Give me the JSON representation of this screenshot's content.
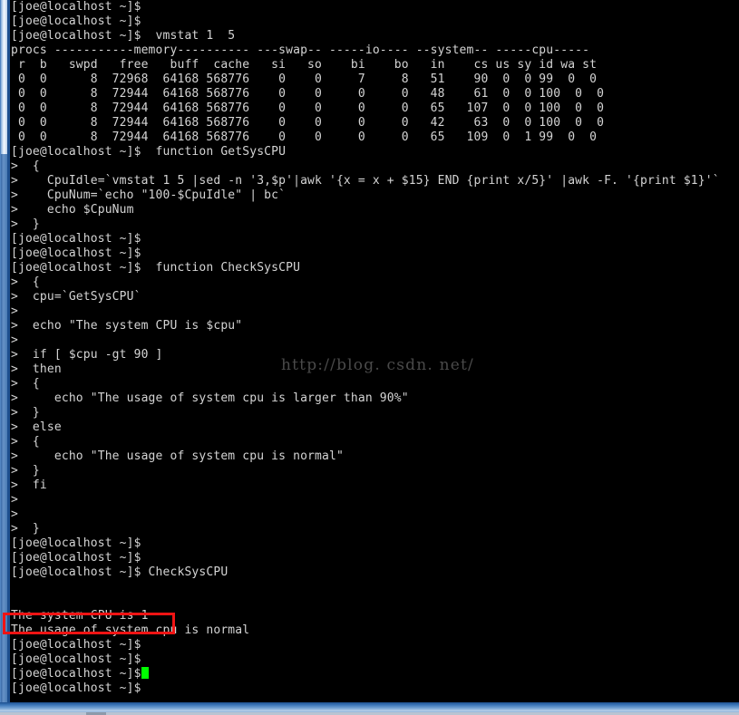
{
  "window": {
    "type": "terminal-emulator",
    "background_color": "#000000",
    "text_color": "#d4d4d4",
    "frame_color": "#3f79ba",
    "cursor_color": "#00ff00"
  },
  "watermark": {
    "text": "http://blog. csdn. net/"
  },
  "annotation": {
    "type": "red-rectangle-highlight",
    "color": "#f01414",
    "targets_line": "The system CPU is 1"
  },
  "terminal": {
    "prompt": "[joe@localhost ~]$",
    "continuation_prompt": ">",
    "lines": [
      "[joe@localhost ~]$",
      "[joe@localhost ~]$",
      "[joe@localhost ~]$  vmstat 1  5",
      "procs -----------memory---------- ---swap-- -----io---- --system-- -----cpu-----",
      " r  b   swpd   free   buff  cache   si   so    bi    bo   in    cs us sy id wa st",
      " 0  0      8  72968  64168 568776    0    0     7     8   51    90  0  0 99  0  0",
      " 0  0      8  72944  64168 568776    0    0     0     0   48    61  0  0 100  0  0",
      " 0  0      8  72944  64168 568776    0    0     0     0   65   107  0  0 100  0  0",
      " 0  0      8  72944  64168 568776    0    0     0     0   42    63  0  0 100  0  0",
      " 0  0      8  72944  64168 568776    0    0     0     0   65   109  0  1 99  0  0",
      "[joe@localhost ~]$  function GetSysCPU",
      ">  {",
      ">    CpuIdle=`vmstat 1 5 |sed -n '3,$p'|awk '{x = x + $15} END {print x/5}' |awk -F. '{print $1}'`",
      ">    CpuNum=`echo \"100-$CpuIdle\" | bc`",
      ">    echo $CpuNum",
      ">  }",
      "[joe@localhost ~]$",
      "[joe@localhost ~]$",
      "[joe@localhost ~]$  function CheckSysCPU",
      ">  {",
      ">  cpu=`GetSysCPU`",
      ">",
      ">  echo \"The system CPU is $cpu\"",
      ">",
      ">  if [ $cpu -gt 90 ]",
      ">  then",
      ">  {",
      ">     echo \"The usage of system cpu is larger than 90%\"",
      ">  }",
      ">  else",
      ">  {",
      ">     echo \"The usage of system cpu is normal\"",
      ">  }",
      ">  fi",
      ">",
      ">",
      ">  }",
      "[joe@localhost ~]$",
      "[joe@localhost ~]$",
      "[joe@localhost ~]$ CheckSysCPU",
      "",
      "",
      "The system CPU is 1",
      "The usage of system cpu is normal",
      "[joe@localhost ~]$",
      "[joe@localhost ~]$",
      "[joe@localhost ~]$",
      "[joe@localhost ~]$ "
    ],
    "cursor_line_index": 46
  }
}
